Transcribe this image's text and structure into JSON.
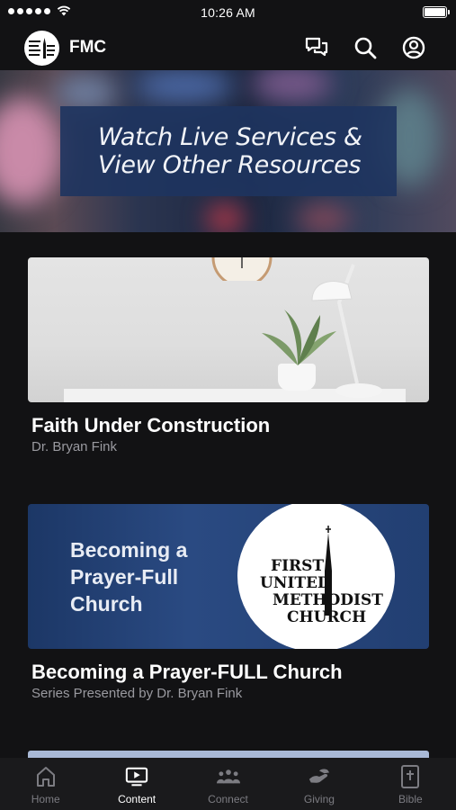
{
  "status": {
    "time": "10:26 AM"
  },
  "header": {
    "title": "FMC",
    "logo_text": "FIRST UNITED METHODIST CHURCH"
  },
  "banner": {
    "line1": "Watch Live Services &",
    "line2": "View Other Resources"
  },
  "cards": [
    {
      "title": "Faith Under Construction",
      "subtitle": "Dr. Bryan Fink"
    },
    {
      "title": "Becoming a Prayer-FULL Church",
      "subtitle": "Series Presented by Dr. Bryan Fink",
      "image_text": [
        "Becoming a",
        "Prayer-Full",
        "Church"
      ],
      "image_logo": [
        "FIRST",
        "UNITED",
        "METHODIST",
        "CHURCH"
      ]
    }
  ],
  "tabs": [
    {
      "label": "Home",
      "icon": "home-icon"
    },
    {
      "label": "Content",
      "icon": "tv-icon",
      "active": true
    },
    {
      "label": "Connect",
      "icon": "people-icon"
    },
    {
      "label": "Giving",
      "icon": "giving-hands-icon"
    },
    {
      "label": "Bible",
      "icon": "bible-icon"
    }
  ],
  "colors": {
    "background": "#121214",
    "banner_box": "#1e345f",
    "tab_inactive": "#7c7c82"
  }
}
